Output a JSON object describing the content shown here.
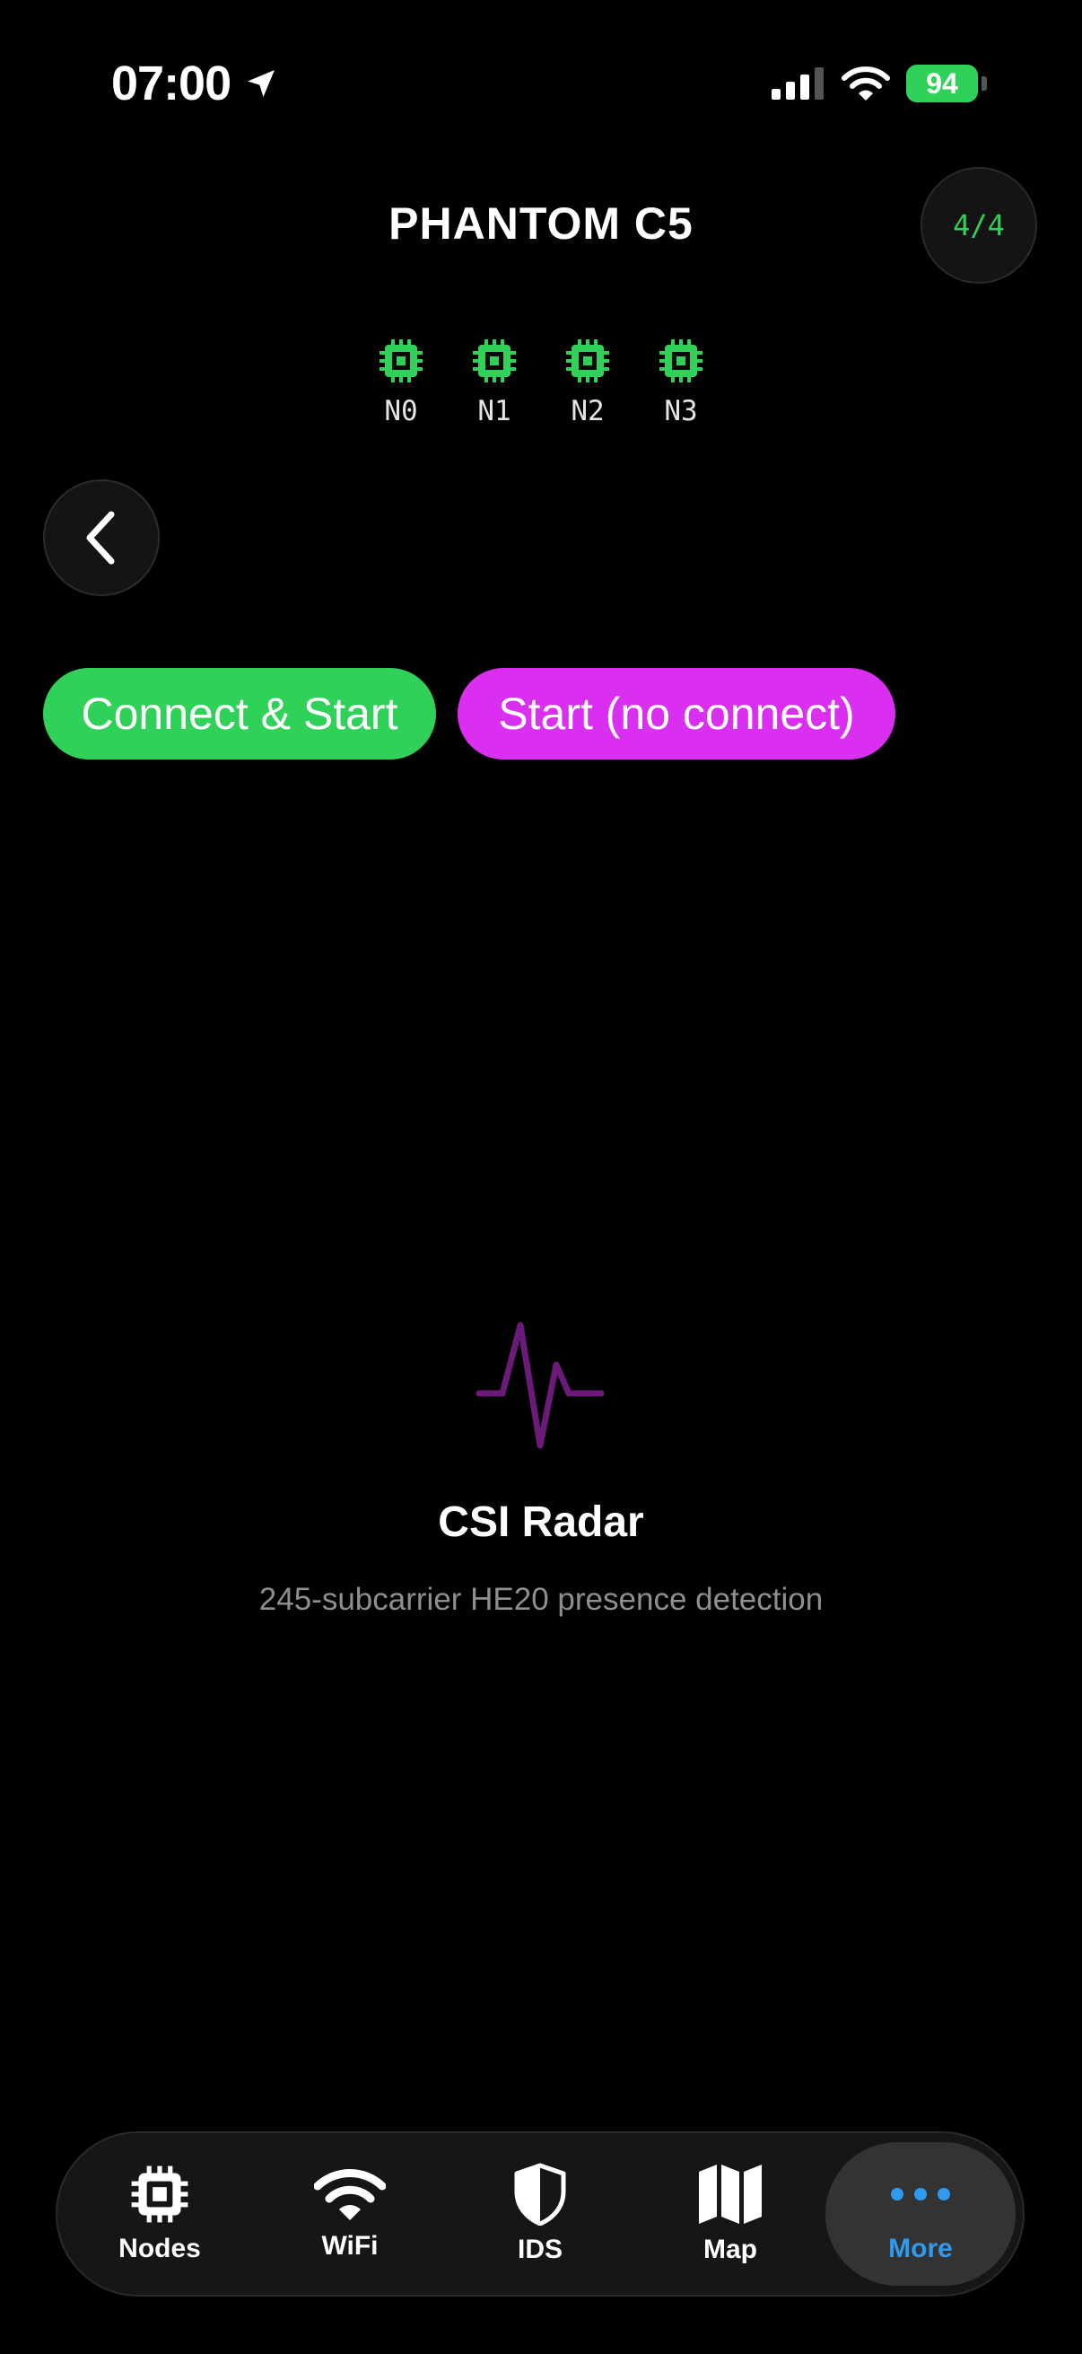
{
  "status": {
    "time": "07:00",
    "battery": "94"
  },
  "header": {
    "title": "PHANTOM C5",
    "counter": "4/4"
  },
  "nodes": [
    {
      "label": "N0"
    },
    {
      "label": "N1"
    },
    {
      "label": "N2"
    },
    {
      "label": "N3"
    }
  ],
  "actions": {
    "connect_start": "Connect & Start",
    "start_no_connect": "Start (no connect)"
  },
  "empty_state": {
    "icon": "waveform-icon",
    "title": "CSI Radar",
    "subtitle": "245-subcarrier HE20 presence detection"
  },
  "tabs": [
    {
      "label": "Nodes",
      "icon": "chip-icon",
      "active": false
    },
    {
      "label": "WiFi",
      "icon": "wifi-icon",
      "active": false
    },
    {
      "label": "IDS",
      "icon": "shield-icon",
      "active": false
    },
    {
      "label": "Map",
      "icon": "map-icon",
      "active": false
    },
    {
      "label": "More",
      "icon": "ellipsis-icon",
      "active": true
    }
  ],
  "colors": {
    "accent_green": "#30d158",
    "accent_magenta": "#da2ff0",
    "waveform": "#6a1b78",
    "tab_active": "#2f9bf0"
  }
}
